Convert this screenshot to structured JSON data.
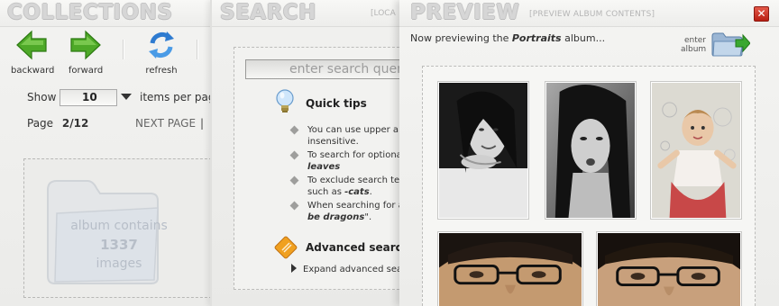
{
  "collections": {
    "title": "COLLECTIONS",
    "toolbar": {
      "backward_label": "backward",
      "forward_label": "forward",
      "refresh_label": "refresh"
    },
    "show_label": "Show",
    "per_page_value": "10",
    "per_page_suffix": "items per pag",
    "page_label": "Page",
    "page_value": "2/12",
    "next_page_label": "NEXT PAGE",
    "separator": "|",
    "album_contains": "album contains",
    "album_count": "1337",
    "album_images": "images"
  },
  "search": {
    "title": "SEARCH",
    "locale_label": "[LOCA",
    "input_placeholder": "enter search quer",
    "quick_tips_title": "Quick tips",
    "tips": [
      {
        "line1": "You can use upper a",
        "line2": "insensitive.",
        "emph": ""
      },
      {
        "line1": "To search for optiona",
        "line2": "",
        "emph": "leaves"
      },
      {
        "line1": "To exclude search te",
        "line2": "such as ",
        "emph": "-cats",
        "tail": "."
      },
      {
        "line1": "When searching for a",
        "line2": "",
        "emph": "be dragons",
        "tail": "\"."
      }
    ],
    "advanced_title": "Advanced search",
    "expand_label": "Expand advanced sea"
  },
  "preview": {
    "title": "PREVIEW",
    "subtitle": "[PREVIEW ALBUM CONTENTS]",
    "close_label": "✕",
    "now_previewing_prefix": "Now previewing the ",
    "album_name": "Portraits",
    "now_previewing_suffix": " album...",
    "enter_label_1": "enter",
    "enter_label_2": "album"
  },
  "colors": {
    "accent_green": "#4ea928",
    "close_red": "#c82a1c",
    "title_gray": "#d6d6d6"
  }
}
